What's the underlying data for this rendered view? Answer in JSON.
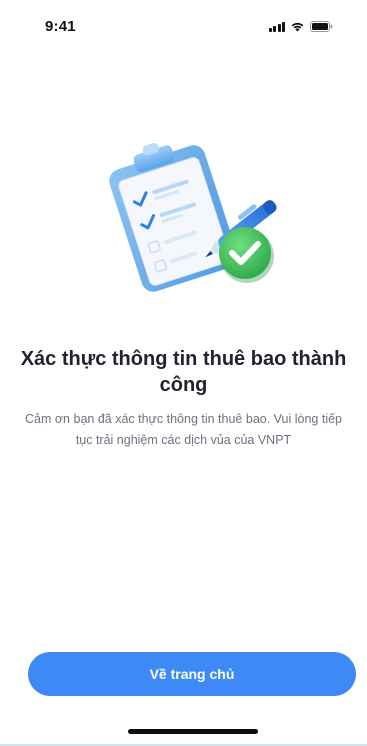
{
  "status_bar": {
    "time": "9:41",
    "icons": [
      "signal-icon",
      "wifi-icon",
      "battery-icon"
    ]
  },
  "illustration": {
    "name": "clipboard-checklist-success-illustration",
    "colors": {
      "clipboard_board": "#6fb0ea",
      "paper": "#eef2f8",
      "check_badge": "#3fbf5a",
      "pen": "#2f7fe6"
    }
  },
  "content": {
    "title": "Xác thực thông tin thuê bao thành công",
    "description": "Cảm ơn bạn đã xác thực thông tin thuê bao. Vui lòng tiếp tục trải nghiệm các dịch vủa của VNPT"
  },
  "actions": {
    "home_button_label": "Về trang chủ"
  },
  "colors": {
    "primary": "#3d8af7",
    "title_text": "#1f2430",
    "body_text": "#6b7280"
  }
}
